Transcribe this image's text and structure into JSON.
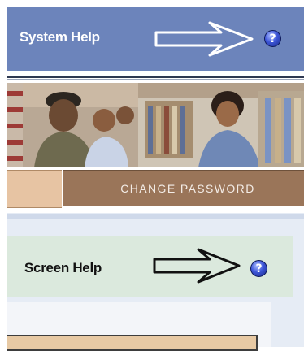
{
  "system_help": {
    "label": "System Help",
    "icon": "question-icon",
    "icon_glyph": "?",
    "bar_color": "#6c84bb"
  },
  "banner": {
    "image": "photo-banner"
  },
  "nav": {
    "change_password_label": "CHANGE PASSWORD",
    "tab_color": "#9a7559"
  },
  "screen_help": {
    "label": "Screen Help",
    "icon": "question-icon",
    "icon_glyph": "?",
    "bar_color": "#dbe9dd"
  }
}
